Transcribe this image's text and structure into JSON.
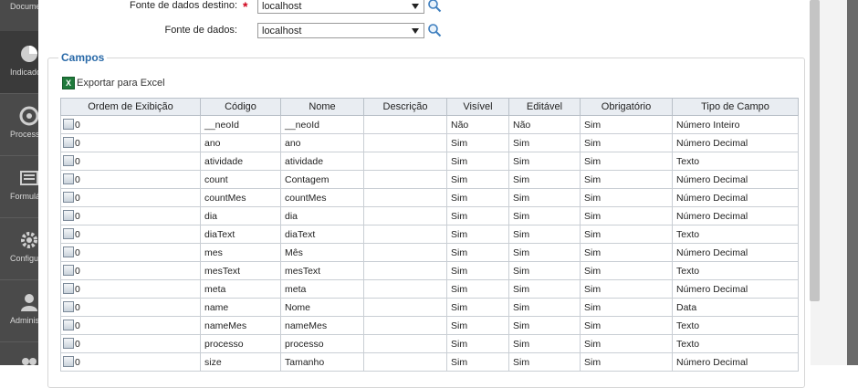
{
  "sidebar": {
    "items": [
      {
        "label": "Docume",
        "icon": "document-icon"
      },
      {
        "label": "Indicado",
        "icon": "pie-chart-icon",
        "active": true
      },
      {
        "label": "Process",
        "icon": "process-icon"
      },
      {
        "label": "Formulá",
        "icon": "form-icon"
      },
      {
        "label": "Configur",
        "icon": "gear-icon"
      },
      {
        "label": "Administ",
        "icon": "user-icon"
      },
      {
        "label": "",
        "icon": "people-icon"
      }
    ]
  },
  "form": {
    "destino_label": "Fonte de dados destino:",
    "destino_value": "localhost",
    "required_mark": "*",
    "fonte_label": "Fonte de dados:",
    "fonte_value": "localhost"
  },
  "campos": {
    "legend": "Campos",
    "export_label": "Exportar para Excel",
    "excel_icon_text": "X",
    "columns": [
      "Ordem de Exibição",
      "Código",
      "Nome",
      "Descrição",
      "Visível",
      "Editável",
      "Obrigatório",
      "Tipo de Campo"
    ],
    "rows": [
      {
        "ordem": "0",
        "codigo": "__neoId",
        "nome": "__neoId",
        "descricao": "",
        "visivel": "Não",
        "editavel": "Não",
        "obrigatorio": "Sim",
        "tipo": "Número Inteiro"
      },
      {
        "ordem": "0",
        "codigo": "ano",
        "nome": "ano",
        "descricao": "",
        "visivel": "Sim",
        "editavel": "Sim",
        "obrigatorio": "Sim",
        "tipo": "Número Decimal"
      },
      {
        "ordem": "0",
        "codigo": "atividade",
        "nome": "atividade",
        "descricao": "",
        "visivel": "Sim",
        "editavel": "Sim",
        "obrigatorio": "Sim",
        "tipo": "Texto"
      },
      {
        "ordem": "0",
        "codigo": "count",
        "nome": "Contagem",
        "descricao": "",
        "visivel": "Sim",
        "editavel": "Sim",
        "obrigatorio": "Sim",
        "tipo": "Número Decimal"
      },
      {
        "ordem": "0",
        "codigo": "countMes",
        "nome": "countMes",
        "descricao": "",
        "visivel": "Sim",
        "editavel": "Sim",
        "obrigatorio": "Sim",
        "tipo": "Número Decimal"
      },
      {
        "ordem": "0",
        "codigo": "dia",
        "nome": "dia",
        "descricao": "",
        "visivel": "Sim",
        "editavel": "Sim",
        "obrigatorio": "Sim",
        "tipo": "Número Decimal"
      },
      {
        "ordem": "0",
        "codigo": "diaText",
        "nome": "diaText",
        "descricao": "",
        "visivel": "Sim",
        "editavel": "Sim",
        "obrigatorio": "Sim",
        "tipo": "Texto"
      },
      {
        "ordem": "0",
        "codigo": "mes",
        "nome": "Mês",
        "descricao": "",
        "visivel": "Sim",
        "editavel": "Sim",
        "obrigatorio": "Sim",
        "tipo": "Número Decimal"
      },
      {
        "ordem": "0",
        "codigo": "mesText",
        "nome": "mesText",
        "descricao": "",
        "visivel": "Sim",
        "editavel": "Sim",
        "obrigatorio": "Sim",
        "tipo": "Texto"
      },
      {
        "ordem": "0",
        "codigo": "meta",
        "nome": "meta",
        "descricao": "",
        "visivel": "Sim",
        "editavel": "Sim",
        "obrigatorio": "Sim",
        "tipo": "Número Decimal"
      },
      {
        "ordem": "0",
        "codigo": "name",
        "nome": "Nome",
        "descricao": "",
        "visivel": "Sim",
        "editavel": "Sim",
        "obrigatorio": "Sim",
        "tipo": "Data"
      },
      {
        "ordem": "0",
        "codigo": "nameMes",
        "nome": "nameMes",
        "descricao": "",
        "visivel": "Sim",
        "editavel": "Sim",
        "obrigatorio": "Sim",
        "tipo": "Texto"
      },
      {
        "ordem": "0",
        "codigo": "processo",
        "nome": "processo",
        "descricao": "",
        "visivel": "Sim",
        "editavel": "Sim",
        "obrigatorio": "Sim",
        "tipo": "Texto"
      },
      {
        "ordem": "0",
        "codigo": "size",
        "nome": "Tamanho",
        "descricao": "",
        "visivel": "Sim",
        "editavel": "Sim",
        "obrigatorio": "Sim",
        "tipo": "Número Decimal"
      }
    ]
  },
  "colors": {
    "sidebar_bg": "#4a4a4a",
    "legend": "#2a6aa8",
    "required": "#d0021b",
    "header_bg": "#e9edf2"
  }
}
